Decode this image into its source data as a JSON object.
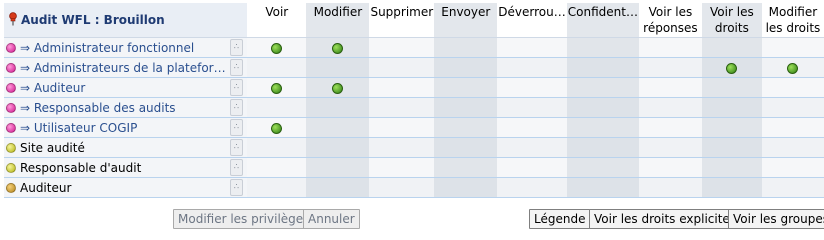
{
  "grid": {
    "title": "Audit WFL : Brouillon",
    "columns": [
      {
        "label": "Voir"
      },
      {
        "label": "Modifier"
      },
      {
        "label": "Supprimer"
      },
      {
        "label": "Envoyer"
      },
      {
        "label": "Déverrou…"
      },
      {
        "label": "Confident…"
      },
      {
        "label": "Voir les réponses"
      },
      {
        "label": "Voir les droits"
      },
      {
        "label": "Modifier les droits"
      }
    ],
    "rows": [
      {
        "label": "⇒ Administrateur fonctionnel",
        "icon": "pink-dot-icon",
        "color": "#d0168f",
        "link": true,
        "rights": [
          true,
          true,
          false,
          false,
          false,
          false,
          false,
          false,
          false
        ]
      },
      {
        "label": "⇒ Administrateurs de la platefor…",
        "icon": "pink-dot-icon",
        "color": "#d0168f",
        "link": true,
        "rights": [
          false,
          false,
          false,
          false,
          false,
          false,
          false,
          true,
          true
        ]
      },
      {
        "label": "⇒ Auditeur",
        "icon": "pink-dot-icon",
        "color": "#d0168f",
        "link": true,
        "rights": [
          true,
          true,
          false,
          false,
          false,
          false,
          false,
          false,
          false
        ]
      },
      {
        "label": "⇒ Responsable des audits",
        "icon": "pink-dot-icon",
        "color": "#d0168f",
        "link": true,
        "rights": [
          false,
          false,
          false,
          false,
          false,
          false,
          false,
          false,
          false
        ]
      },
      {
        "label": "⇒ Utilisateur COGIP",
        "icon": "pink-dot-icon",
        "color": "#d0168f",
        "link": true,
        "rights": [
          true,
          false,
          false,
          false,
          false,
          false,
          false,
          false,
          false
        ]
      },
      {
        "label": "Site audité",
        "icon": "yellow-dot-icon",
        "color": "#b5b512",
        "link": false,
        "rights": [
          false,
          false,
          false,
          false,
          false,
          false,
          false,
          false,
          false
        ]
      },
      {
        "label": "Responsable d'audit",
        "icon": "yellow-dot-icon",
        "color": "#b5b512",
        "link": false,
        "rights": [
          false,
          false,
          false,
          false,
          false,
          false,
          false,
          false,
          false
        ]
      },
      {
        "label": "Auditeur",
        "icon": "orange-dot-icon",
        "color": "#b4851a",
        "link": false,
        "rights": [
          false,
          false,
          false,
          false,
          false,
          false,
          false,
          false,
          false
        ]
      }
    ],
    "granted_color": "#2e7d12"
  },
  "buttons": {
    "modify": "Modifier les privilèges",
    "cancel": "Annuler",
    "legend": "Légende",
    "explicit_rights": "Voir les droits explicites",
    "groups": "Voir les groupes"
  }
}
